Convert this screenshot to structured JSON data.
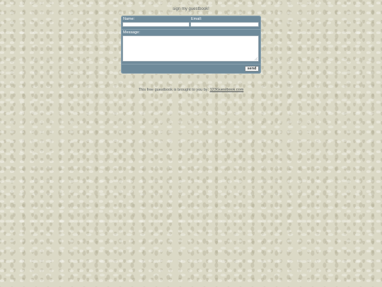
{
  "caption": "sign my guestbook!",
  "form": {
    "name_label": "Name:",
    "name_value": "",
    "email_label": "Email:",
    "email_value": "",
    "message_label": "Message:",
    "message_value": "",
    "send_label": "send"
  },
  "footer": {
    "credit_text": "This free guestbook is brought to you by:",
    "link_text": "123Guestbook.com"
  },
  "colors": {
    "background": "#dbd9c6",
    "form_panel": "#6e8a9a"
  }
}
